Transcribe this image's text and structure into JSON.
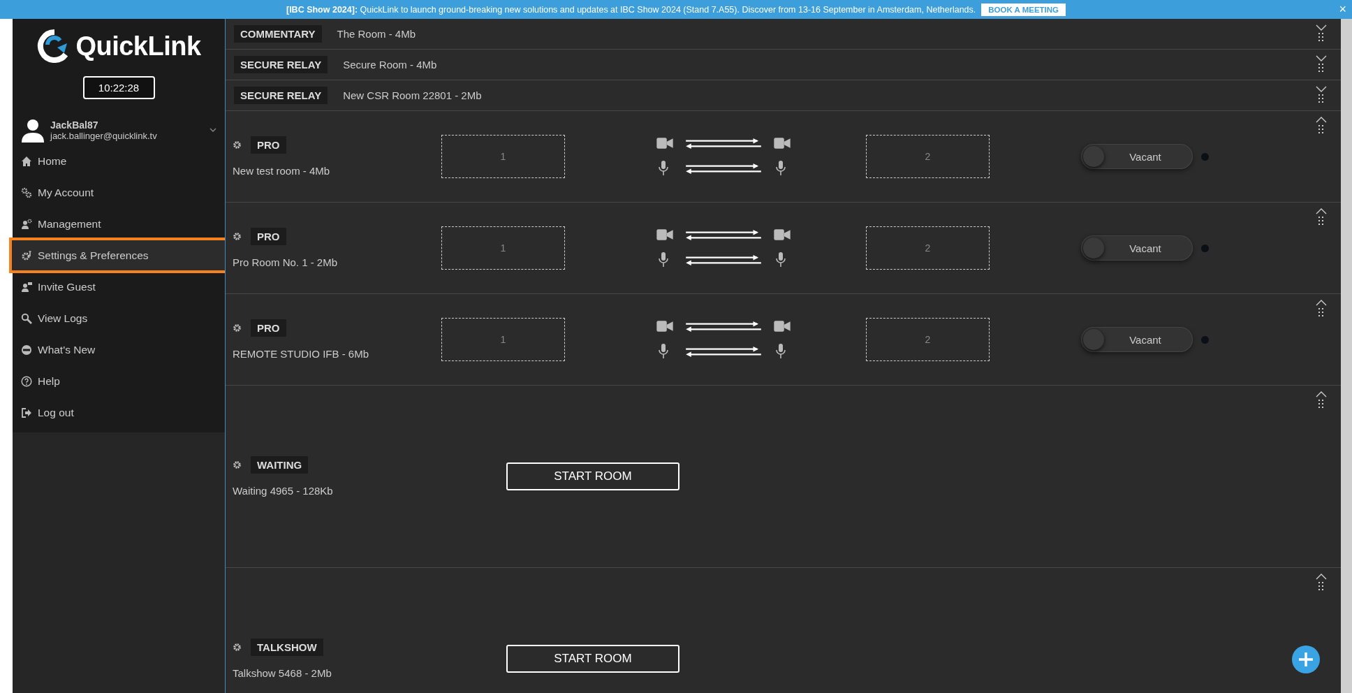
{
  "banner": {
    "message": "**[IBC Show 2024]:** QuickLink to launch ground-breaking new solutions and updates at IBC Show 2024 (Stand 7.A55). Discover from 13-16 September in Amsterdam, Netherlands.",
    "button": "BOOK A MEETING",
    "close": "×"
  },
  "sidebar": {
    "logo": "QuickLink",
    "clock": "10:22:28",
    "user": {
      "name": "JackBal87",
      "email": "jack.ballinger@quicklink.tv"
    },
    "items": [
      {
        "label": "Home",
        "selected": false
      },
      {
        "label": "My Account",
        "selected": false
      },
      {
        "label": "Management",
        "selected": false
      },
      {
        "label": "Settings & Preferences",
        "selected": true
      },
      {
        "label": "Invite Guest",
        "selected": false
      },
      {
        "label": "View Logs",
        "selected": false
      },
      {
        "label": "What's New",
        "selected": false
      },
      {
        "label": "Help",
        "selected": false
      },
      {
        "label": "Log out",
        "selected": false
      }
    ]
  },
  "rooms": [
    {
      "kind": "collapsed",
      "type": "COMMENTARY",
      "name": "The Room - 4Mb",
      "expanded": false
    },
    {
      "kind": "collapsed",
      "type": "SECURE RELAY",
      "name": "Secure Room - 4Mb",
      "expanded": false
    },
    {
      "kind": "collapsed",
      "type": "SECURE RELAY",
      "name": "New CSR Room 22801 - 2Mb",
      "expanded": false
    },
    {
      "kind": "pro",
      "type": "PRO",
      "name": "New test room - 4Mb",
      "slots": [
        "1",
        "2"
      ],
      "status": "Vacant",
      "on": false,
      "expanded": true
    },
    {
      "kind": "pro",
      "type": "PRO",
      "name": "Pro Room No. 1 - 2Mb",
      "slots": [
        "1",
        "2"
      ],
      "status": "Vacant",
      "on": false,
      "expanded": true
    },
    {
      "kind": "pro",
      "type": "PRO",
      "name": "REMOTE STUDIO IFB - 6Mb",
      "slots": [
        "1",
        "2"
      ],
      "status": "Vacant",
      "on": false,
      "expanded": true
    },
    {
      "kind": "waiting",
      "type": "WAITING",
      "name": "Waiting 4965 - 128Kb",
      "button": "START ROOM",
      "expanded": true
    },
    {
      "kind": "waiting",
      "type": "TALKSHOW",
      "name": "Talkshow 5468 - 2Mb",
      "button": "START ROOM",
      "expanded": true
    }
  ]
}
